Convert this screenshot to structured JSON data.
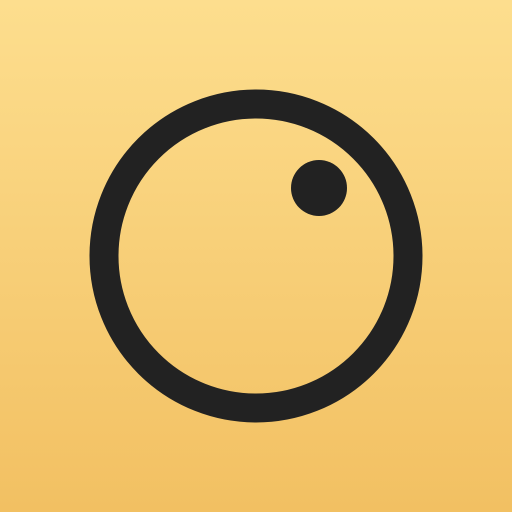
{
  "icon": {
    "name": "ring-with-dot-logo",
    "colors": {
      "background_top": "#FDDE8E",
      "background_bottom": "#F2C062",
      "glyph": "#222222"
    }
  }
}
